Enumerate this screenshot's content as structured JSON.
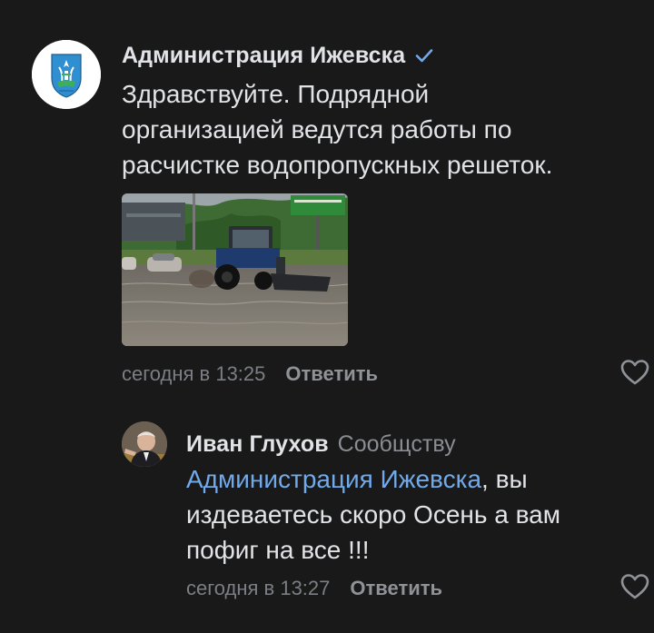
{
  "comments": [
    {
      "author": "Администрация Ижевска",
      "verified": true,
      "text": "Здравствуйте. Подрядной\nорганизацией ведутся работы по\nрасчистке водопропускных решеток.",
      "photo": "tractor-in-flooded-street",
      "date": "сегодня в 13:25",
      "reply_label": "Ответить",
      "like_icon": "heart-outline-icon"
    },
    {
      "author": "Иван Глухов",
      "author_context": "Сообщству",
      "mention": "Администрация Ижевска",
      "text_after_mention": ", вы\nиздеваетесь скоро Осень а вам\nпофиг на все !!!",
      "date": "сегодня в 13:27",
      "reply_label": "Ответить",
      "like_icon": "heart-outline-icon"
    }
  ],
  "colors": {
    "background": "#19191a",
    "text": "#e1e3e6",
    "secondary": "#7b7e83",
    "link": "#71aaeb",
    "verified": "#71aaeb"
  }
}
